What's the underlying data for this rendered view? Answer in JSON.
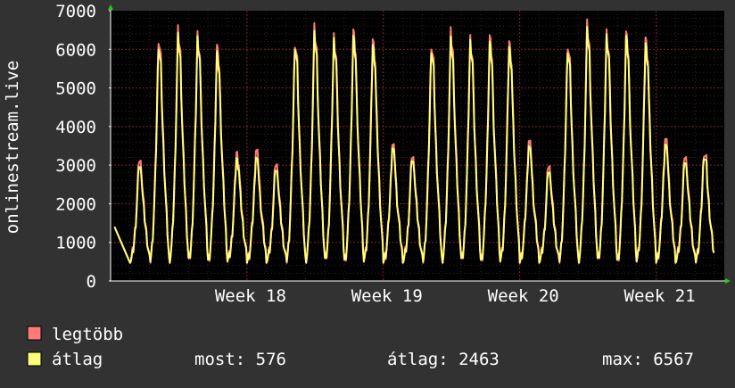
{
  "colors": {
    "background": "#323232",
    "plot_background": "#000000",
    "grid_major": "#7a2a2a",
    "grid_minor": "#3a2222",
    "axis": "#ffffff",
    "arrow": "#1ecc1e",
    "series_max": "#ff7b7b",
    "series_avg": "#ffff7b"
  },
  "chart_data": {
    "type": "line",
    "ylabel": "onlinestream.live",
    "ylim": [
      0,
      7000
    ],
    "y_ticks": [
      0,
      1000,
      2000,
      3000,
      4000,
      5000,
      6000,
      7000
    ],
    "y_tick_labels": [
      "0",
      "1000",
      "2000",
      "3000",
      "4000",
      "5000",
      "6000",
      "7000"
    ],
    "x_tick_labels": [
      "Week 18",
      "Week 19",
      "Week 20",
      "Week 21"
    ],
    "x_tick_positions_days": [
      7,
      14,
      21,
      28
    ],
    "x_range_days": [
      0,
      31.5
    ],
    "grid": true,
    "legend": {
      "placement": "bottom-left"
    },
    "series": [
      {
        "name": "legtöbb",
        "color": "#ff7b7b",
        "daily_peaks": [
          3200,
          6350,
          6500,
          6400,
          6100,
          3350,
          3450,
          3100,
          6250,
          6550,
          6350,
          6500,
          6300,
          3600,
          3300,
          6200,
          6450,
          6300,
          6350,
          6250,
          3700,
          3050,
          6200,
          6650,
          6450,
          6450,
          6350,
          3750,
          3300,
          3400
        ]
      },
      {
        "name": "átlag",
        "color": "#ffff7b",
        "daily_peaks": [
          3050,
          6150,
          6350,
          6300,
          5950,
          3200,
          3250,
          2950,
          6150,
          6400,
          6250,
          6350,
          6150,
          3500,
          3200,
          6050,
          6250,
          6200,
          6200,
          6100,
          3550,
          2900,
          6050,
          6500,
          6350,
          6350,
          6200,
          3600,
          3150,
          3300
        ]
      }
    ],
    "trough_value": 550
  },
  "legend": [
    {
      "label": "legtöbb",
      "color": "#ff7b7b"
    },
    {
      "label": "átlag",
      "color": "#ffff7b"
    }
  ],
  "stats": {
    "current": "most: 576",
    "average": "átlag: 2463",
    "max": "max: 6567"
  }
}
